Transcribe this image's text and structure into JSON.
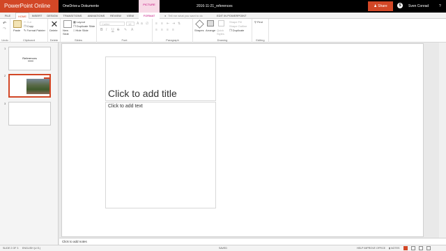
{
  "app": {
    "name": "PowerPoint Online",
    "breadcrumb": "OneDrive ▸ Dokumente",
    "document_title": "2016-11-21_references",
    "share_label": "Share",
    "skype_glyph": "S",
    "user_name": "Sven Conrad",
    "help_label": "?"
  },
  "tabs": [
    {
      "label": "FILE"
    },
    {
      "label": "HOME"
    },
    {
      "label": "INSERT"
    },
    {
      "label": "DESIGN"
    },
    {
      "label": "TRANSITIONS"
    },
    {
      "label": "ANIMATIONS"
    },
    {
      "label": "REVIEW"
    },
    {
      "label": "VIEW"
    },
    {
      "label": "FORMAT"
    }
  ],
  "picture_tools_label": "PICTURE TOOLS",
  "tell_me": {
    "placeholder": "Tell me what you want to do"
  },
  "edit_in_powerpoint": "EDIT IN POWERPOINT",
  "ribbon": {
    "undo": {
      "label": "Undo"
    },
    "clipboard": {
      "paste": "Paste",
      "cut": "Cut",
      "copy": "Copy",
      "format_painter": "Format Painter",
      "group": "Clipboard"
    },
    "delete": {
      "label": "Delete",
      "group": "Delete"
    },
    "slides": {
      "new_slide": "New Slide",
      "layout": "Layout",
      "duplicate": "Duplicate Slide",
      "hide": "Hide Slide",
      "group": "Slides"
    },
    "font": {
      "family": "Calibri",
      "size": "18",
      "group": "Font"
    },
    "paragraph": {
      "group": "Paragraph"
    },
    "drawing": {
      "shapes": "Shapes",
      "arrange": "Arrange",
      "quick_styles": "Quick Styles",
      "shape_fill": "Shape Fill",
      "shape_outline": "Shape Outline",
      "duplicate": "Duplicate",
      "group": "Drawing"
    },
    "editing": {
      "find": "Find",
      "group": "Editing"
    }
  },
  "slides_pane": [
    {
      "number": "1",
      "title": "References"
    },
    {
      "number": "2",
      "title": ""
    },
    {
      "number": "3",
      "title": ""
    }
  ],
  "slide": {
    "title_placeholder": "Click to add title",
    "body_placeholder": "Click to add text"
  },
  "notes_placeholder": "Click to add notes",
  "status": {
    "slide_counter": "SLIDE 2 OF 3",
    "language": "ENGLISH (U.S.)",
    "save_state": "SAVED",
    "help_improve": "HELP IMPROVE OFFICE",
    "notes": "NOTES"
  },
  "colors": {
    "accent": "#d24726",
    "picture_tools": "#c00077"
  }
}
